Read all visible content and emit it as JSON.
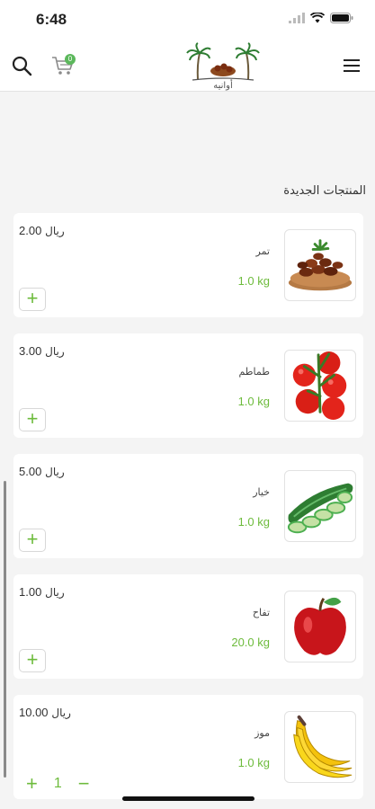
{
  "status_bar": {
    "time": "6:48"
  },
  "header": {
    "cart_count": "0",
    "logo_text": "أوانيه"
  },
  "section_title": "المنتجات الجديدة",
  "currency": "ريال",
  "products": [
    {
      "price": "2.00",
      "name": "تمر",
      "weight": "1.0 kg",
      "image": "dates"
    },
    {
      "price": "3.00",
      "name": "طماطم",
      "weight": "1.0 kg",
      "image": "tomato"
    },
    {
      "price": "5.00",
      "name": "خيار",
      "weight": "1.0 kg",
      "image": "cucumber"
    },
    {
      "price": "1.00",
      "name": "تفاح",
      "weight": "20.0 kg",
      "image": "apple"
    },
    {
      "price": "10.00",
      "name": "موز",
      "weight": "1.0 kg",
      "image": "banana",
      "qty": "1"
    }
  ],
  "colors": {
    "accent": "#6dbb3c",
    "badge": "#5cb85c",
    "background": "#f4f4f4"
  }
}
